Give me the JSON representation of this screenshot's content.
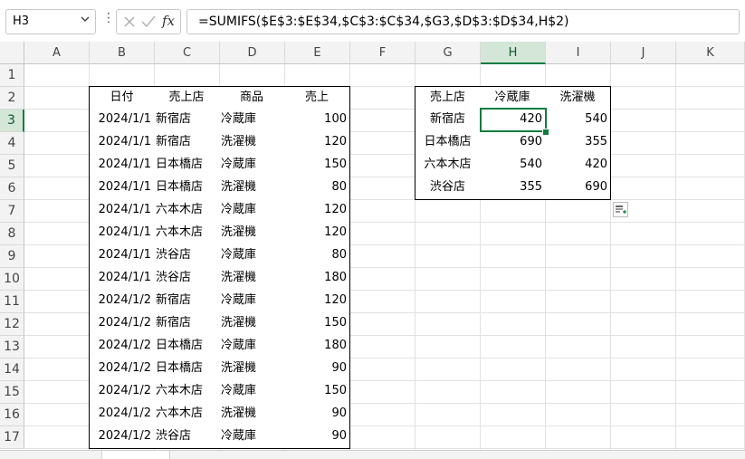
{
  "name_box": "H3",
  "formula": "=SUMIFS($E$3:$E$34,$C$3:$C$34,$G3,$D$3:$D$34,H$2)",
  "columns": [
    "A",
    "B",
    "C",
    "D",
    "E",
    "F",
    "G",
    "H",
    "I",
    "J",
    "K"
  ],
  "rows": [
    "1",
    "2",
    "3",
    "4",
    "5",
    "6",
    "7",
    "8",
    "9",
    "10",
    "11",
    "12",
    "13",
    "14",
    "15",
    "16",
    "17"
  ],
  "selected_column": "H",
  "selected_row": "3",
  "sales_table": {
    "headers": [
      "日付",
      "売上店",
      "商品",
      "売上"
    ],
    "rows": [
      [
        "2024/1/1",
        "新宿店",
        "冷蔵庫",
        "100"
      ],
      [
        "2024/1/1",
        "新宿店",
        "洗濯機",
        "120"
      ],
      [
        "2024/1/1",
        "日本橋店",
        "冷蔵庫",
        "150"
      ],
      [
        "2024/1/1",
        "日本橋店",
        "洗濯機",
        "80"
      ],
      [
        "2024/1/1",
        "六本木店",
        "冷蔵庫",
        "120"
      ],
      [
        "2024/1/1",
        "六本木店",
        "洗濯機",
        "120"
      ],
      [
        "2024/1/1",
        "渋谷店",
        "冷蔵庫",
        "80"
      ],
      [
        "2024/1/1",
        "渋谷店",
        "洗濯機",
        "180"
      ],
      [
        "2024/1/2",
        "新宿店",
        "冷蔵庫",
        "120"
      ],
      [
        "2024/1/2",
        "新宿店",
        "洗濯機",
        "150"
      ],
      [
        "2024/1/2",
        "日本橋店",
        "冷蔵庫",
        "180"
      ],
      [
        "2024/1/2",
        "日本橋店",
        "洗濯機",
        "90"
      ],
      [
        "2024/1/2",
        "六本木店",
        "冷蔵庫",
        "150"
      ],
      [
        "2024/1/2",
        "六本木店",
        "洗濯機",
        "90"
      ],
      [
        "2024/1/2",
        "渋谷店",
        "冷蔵庫",
        "90"
      ]
    ]
  },
  "summary_table": {
    "headers": [
      "売上店",
      "冷蔵庫",
      "洗濯機"
    ],
    "rows": [
      [
        "新宿店",
        "420",
        "540"
      ],
      [
        "日本橋店",
        "690",
        "355"
      ],
      [
        "六本木店",
        "540",
        "420"
      ],
      [
        "渋谷店",
        "355",
        "690"
      ]
    ]
  },
  "icons": {
    "cancel": "x-icon",
    "enter": "check-icon",
    "function": "fx-icon",
    "name_box_dropdown": "chevron-down-icon",
    "quick_analysis": "quick-analysis-icon"
  },
  "colors": {
    "accent": "#107c41",
    "header_bg": "#f3f3f3",
    "selected_header_bg": "#d3e6d8"
  }
}
